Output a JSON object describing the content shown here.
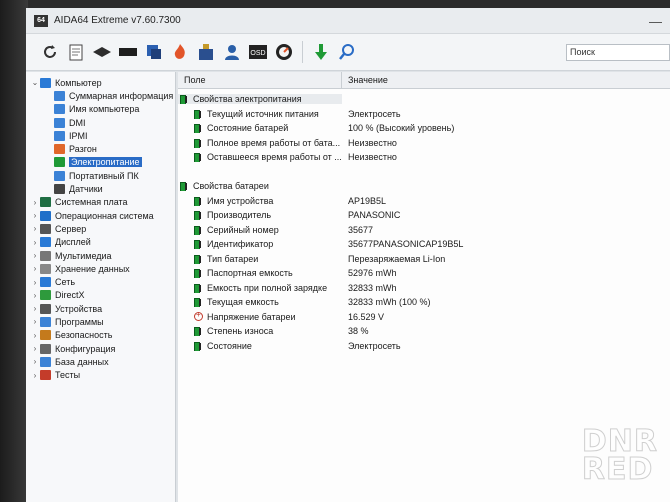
{
  "window": {
    "title": "AIDA64 Extreme v7.60.7300",
    "logo_text": "64"
  },
  "toolbar": {
    "buttons": [
      "refresh-icon",
      "report-icon",
      "motherboard-icon",
      "memory-icon",
      "flash-icon",
      "stress-icon",
      "benchmark-icon",
      "user-icon",
      "osd-icon",
      "sensor-icon",
      "update-icon",
      "search-icon"
    ],
    "search_label": "Поиск"
  },
  "tree": {
    "items": [
      {
        "label": "Компьютер",
        "level": 0,
        "chevron": "⌄",
        "icon_color": "#2a7ad6"
      },
      {
        "label": "Суммарная информация",
        "level": 1,
        "chevron": "",
        "icon_color": "#3b82d6"
      },
      {
        "label": "Имя компьютера",
        "level": 1,
        "chevron": "",
        "icon_color": "#3b82d6"
      },
      {
        "label": "DMI",
        "level": 1,
        "chevron": "",
        "icon_color": "#3b82d6"
      },
      {
        "label": "IPMI",
        "level": 1,
        "chevron": "",
        "icon_color": "#3b82d6"
      },
      {
        "label": "Разгон",
        "level": 1,
        "chevron": "",
        "icon_color": "#e0672a"
      },
      {
        "label": "Электропитание",
        "level": 1,
        "chevron": "",
        "icon_color": "#1f9a36",
        "selected": true
      },
      {
        "label": "Портативный ПК",
        "level": 1,
        "chevron": "",
        "icon_color": "#3b82d6"
      },
      {
        "label": "Датчики",
        "level": 1,
        "chevron": "",
        "icon_color": "#444444"
      },
      {
        "label": "Системная плата",
        "level": 0,
        "chevron": "›",
        "icon_color": "#1f6e43"
      },
      {
        "label": "Операционная система",
        "level": 0,
        "chevron": "›",
        "icon_color": "#1f6fc9"
      },
      {
        "label": "Сервер",
        "level": 0,
        "chevron": "›",
        "icon_color": "#555555"
      },
      {
        "label": "Дисплей",
        "level": 0,
        "chevron": "›",
        "icon_color": "#2a7ad6"
      },
      {
        "label": "Мультимедиа",
        "level": 0,
        "chevron": "›",
        "icon_color": "#777777"
      },
      {
        "label": "Хранение данных",
        "level": 0,
        "chevron": "›",
        "icon_color": "#888888"
      },
      {
        "label": "Сеть",
        "level": 0,
        "chevron": "›",
        "icon_color": "#2a7ad6"
      },
      {
        "label": "DirectX",
        "level": 0,
        "chevron": "›",
        "icon_color": "#2e9a3c"
      },
      {
        "label": "Устройства",
        "level": 0,
        "chevron": "›",
        "icon_color": "#555555"
      },
      {
        "label": "Программы",
        "level": 0,
        "chevron": "›",
        "icon_color": "#3b82d6"
      },
      {
        "label": "Безопасность",
        "level": 0,
        "chevron": "›",
        "icon_color": "#c47a1c"
      },
      {
        "label": "Конфигурация",
        "level": 0,
        "chevron": "›",
        "icon_color": "#666666"
      },
      {
        "label": "База данных",
        "level": 0,
        "chevron": "›",
        "icon_color": "#3b82d6"
      },
      {
        "label": "Тесты",
        "level": 0,
        "chevron": "›",
        "icon_color": "#c43c2a"
      }
    ]
  },
  "table": {
    "col_field": "Поле",
    "col_value": "Значение",
    "sections": [
      {
        "title": "Свойства электропитания",
        "rows": [
          {
            "field": "Текущий источник питания",
            "value": "Электросеть",
            "icon": "battery"
          },
          {
            "field": "Состояние батарей",
            "value": "100 % (Высокий уровень)",
            "icon": "battery"
          },
          {
            "field": "Полное время работы от бата...",
            "value": "Неизвестно",
            "icon": "battery"
          },
          {
            "field": "Оставшееся время работы от ...",
            "value": "Неизвестно",
            "icon": "battery"
          }
        ]
      },
      {
        "title": "Свойства батареи",
        "rows": [
          {
            "field": "Имя устройства",
            "value": "AP19B5L",
            "icon": "battery"
          },
          {
            "field": "Производитель",
            "value": "PANASONIC",
            "icon": "battery"
          },
          {
            "field": "Серийный номер",
            "value": "35677",
            "icon": "battery"
          },
          {
            "field": "Идентификатор",
            "value": "35677PANASONICAP19B5L",
            "icon": "battery"
          },
          {
            "field": "Тип батареи",
            "value": "Перезаряжаемая Li-Ion",
            "icon": "battery"
          },
          {
            "field": "Паспортная емкость",
            "value": "52976 mWh",
            "icon": "battery"
          },
          {
            "field": "Емкость при полной зарядке",
            "value": "32833 mWh",
            "icon": "battery"
          },
          {
            "field": "Текущая емкость",
            "value": "32833 mWh  (100 %)",
            "icon": "battery"
          },
          {
            "field": "Напряжение батареи",
            "value": "16.529 V",
            "icon": "voltage"
          },
          {
            "field": "Степень износа",
            "value": "38 %",
            "icon": "battery"
          },
          {
            "field": "Состояние",
            "value": "Электросеть",
            "icon": "battery"
          }
        ]
      }
    ]
  },
  "watermark": {
    "line1": "DNR",
    "line2": "RED"
  }
}
